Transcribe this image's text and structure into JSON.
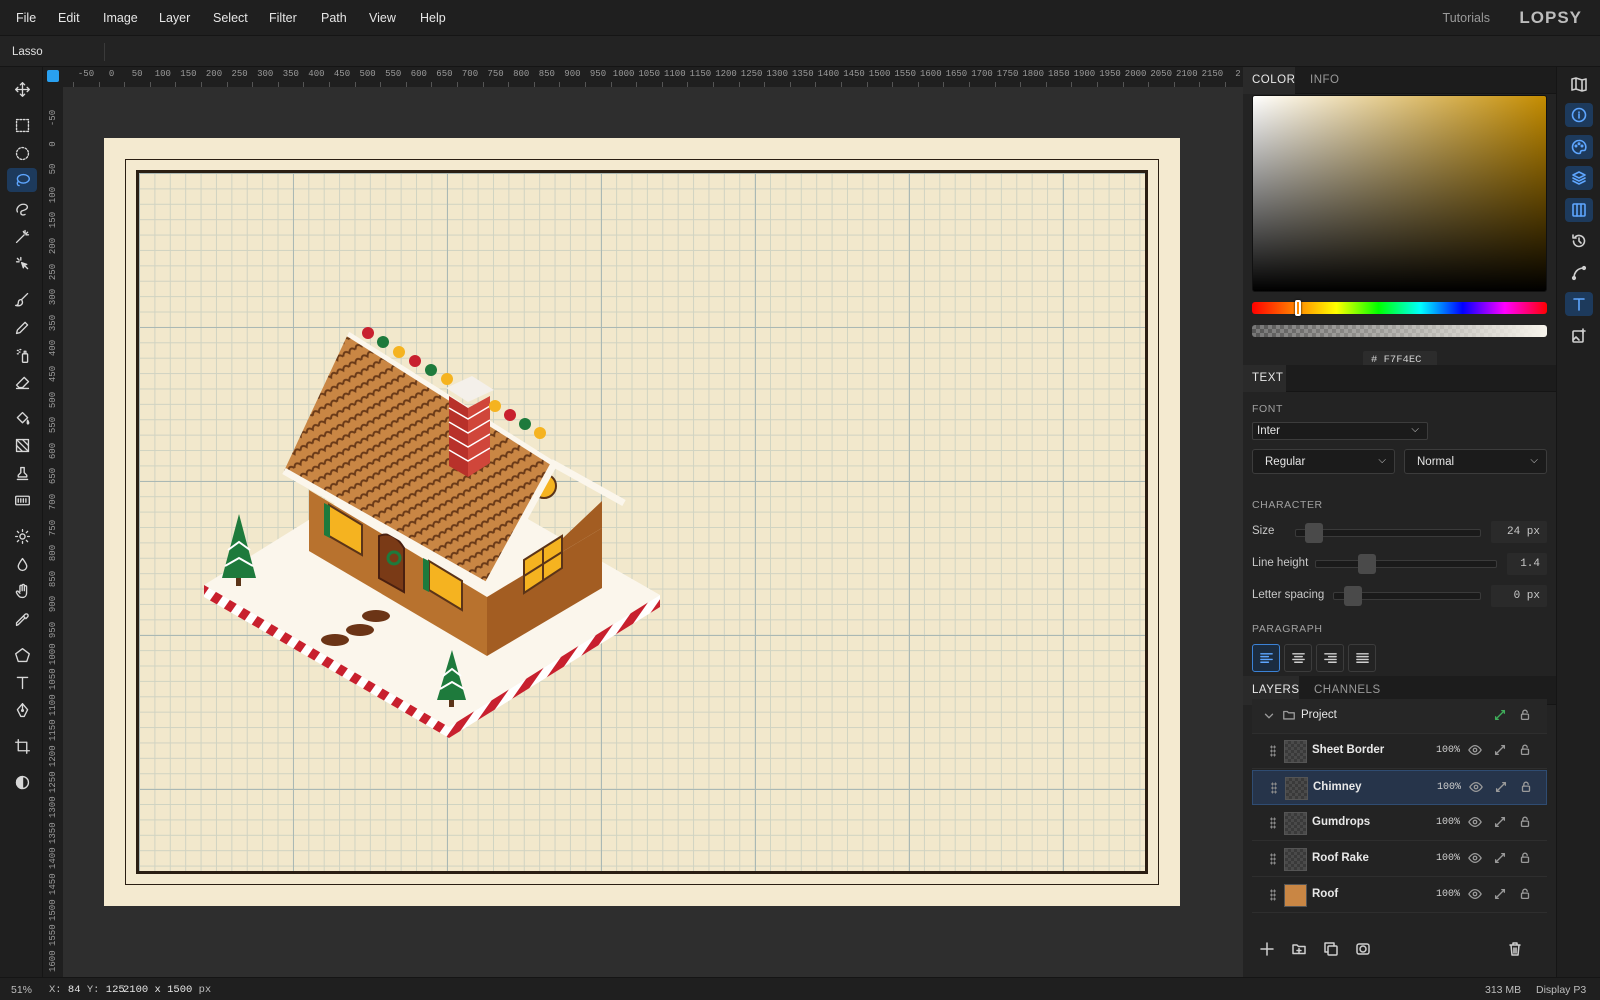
{
  "menu": {
    "items": [
      "File",
      "Edit",
      "Image",
      "Layer",
      "Select",
      "Filter",
      "Path",
      "View",
      "Help"
    ],
    "tutorials": "Tutorials",
    "logo": "LOPSY"
  },
  "options": {
    "tool_name": "Lasso"
  },
  "toolbar": {
    "active": "lasso-tool",
    "tools": [
      "move-tool",
      "rect-select-tool",
      "ellipse-select-tool",
      "lasso-tool",
      "quick-select-tool",
      "magic-wand-tool",
      "object-select-tool",
      "brush-tool",
      "pencil-tool",
      "spray-tool",
      "eraser-tool",
      "bucket-tool",
      "gradient-tool",
      "stamp-tool",
      "pattern-tool",
      "dodge-tool",
      "blur-tool",
      "hand-tool",
      "eyedropper-tool",
      "polygon-tool",
      "text-tool",
      "pen-tool",
      "crop-tool",
      "contrast-tool"
    ]
  },
  "rulers": {
    "h_labels": [
      "-50",
      "0",
      "50",
      "100",
      "150",
      "200",
      "250",
      "300",
      "350",
      "400",
      "450",
      "500",
      "550",
      "600",
      "650",
      "700",
      "750",
      "800",
      "850",
      "900",
      "950",
      "1000",
      "1050",
      "1100",
      "1150",
      "1200",
      "1250",
      "1300",
      "1350",
      "1400",
      "1450",
      "1500",
      "1550",
      "1600",
      "1650",
      "1700",
      "1750",
      "1800",
      "1850",
      "1900",
      "1950",
      "2000",
      "2050",
      "2100",
      "2150",
      "2"
    ],
    "v_labels": [
      "-50",
      "0",
      "50",
      "100",
      "150",
      "200",
      "250",
      "300",
      "350",
      "400",
      "450",
      "500",
      "550",
      "600",
      "650",
      "700",
      "750",
      "800",
      "850",
      "900",
      "950",
      "1000",
      "1050",
      "1100",
      "1150",
      "1200",
      "1250",
      "1300",
      "1350",
      "1400",
      "1450",
      "1500",
      "1550",
      "1600"
    ]
  },
  "color_panel": {
    "tabs": [
      "COLOR",
      "INFO"
    ],
    "active_tab": "COLOR",
    "hue_color": "#c48c00",
    "hex_prefix": "#",
    "hex": "F7F4EC"
  },
  "text_panel": {
    "tab": "TEXT",
    "font_label": "FONT",
    "font": "Inter",
    "weight": "Regular",
    "style": "Normal",
    "character_label": "CHARACTER",
    "size_label": "Size",
    "size": "24 px",
    "line_height_label": "Line height",
    "line_height": "1.4",
    "letter_spacing_label": "Letter spacing",
    "letter_spacing": "0 px",
    "paragraph_label": "PARAGRAPH",
    "align": "left"
  },
  "layers_panel": {
    "tabs": [
      "LAYERS",
      "CHANNELS"
    ],
    "active_tab": "LAYERS",
    "group": "Project",
    "layers": [
      {
        "name": "Sheet Border",
        "opacity": "100%"
      },
      {
        "name": "Chimney",
        "opacity": "100%",
        "selected": true
      },
      {
        "name": "Gumdrops",
        "opacity": "100%"
      },
      {
        "name": "Roof Rake",
        "opacity": "100%"
      },
      {
        "name": "Roof",
        "opacity": "100%"
      }
    ]
  },
  "status": {
    "zoom": "51%",
    "x_label": "X:",
    "x": "84",
    "y_label": "Y:",
    "y": "125",
    "doc_size": "2100 x 1500",
    "unit": "px",
    "memory": "313 MB",
    "profile": "Display P3"
  }
}
